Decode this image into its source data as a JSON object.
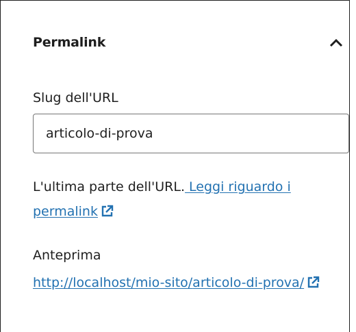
{
  "panel": {
    "title": "Permalink",
    "toggle_icon": "chevron-up-icon"
  },
  "slug_field": {
    "label": "Slug dell'URL",
    "value": "articolo-di-prova"
  },
  "help": {
    "text": "L'ultima parte dell'URL.",
    "link_text": " Leggi riguardo i permalink",
    "external_icon": "external-link-icon"
  },
  "preview": {
    "label": "Anteprima",
    "base_url": "http://localhost/mio-sito/",
    "slug_part": "articolo-di-prova/",
    "external_icon": "external-link-icon"
  },
  "colors": {
    "link": "#2271b1",
    "text": "#1e1e1e",
    "input_border": "#757575"
  }
}
